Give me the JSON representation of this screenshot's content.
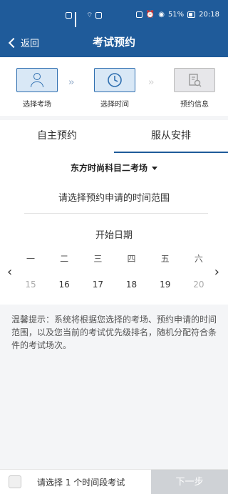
{
  "status_bar": {
    "left_label": "",
    "battery": "51%",
    "time": "20:18"
  },
  "nav": {
    "back_label": "返回",
    "title": "考试预约"
  },
  "steps": [
    {
      "label": "选择考场",
      "icon": "person-icon",
      "active": true
    },
    {
      "label": "选择时间",
      "icon": "clock-icon",
      "active": true
    },
    {
      "label": "预约信息",
      "icon": "document-search-icon",
      "active": false
    }
  ],
  "tabs": [
    {
      "label": "自主预约",
      "active": false
    },
    {
      "label": "服从安排",
      "active": true
    }
  ],
  "content": {
    "venue": "东方时尚科目二考场",
    "prompt": "请选择预约申请的时间范围",
    "start_label": "开始日期",
    "weekdays": [
      "一",
      "二",
      "三",
      "四",
      "五",
      "六"
    ],
    "dates": [
      "15",
      "16",
      "17",
      "18",
      "19",
      "20"
    ]
  },
  "tip": {
    "text": "温馨提示：系统将根据您选择的考场、预约申请的时间范围，以及您当前的考试优先级排名，随机分配符合条件的考试场次。"
  },
  "bottom": {
    "text": "请选择 1 个时间段考试",
    "next_label": "下一步"
  },
  "colors": {
    "brand": "#1f5b9a",
    "step_active_bg": "#d9e8f6",
    "disabled_button": "#cfd2d6"
  }
}
